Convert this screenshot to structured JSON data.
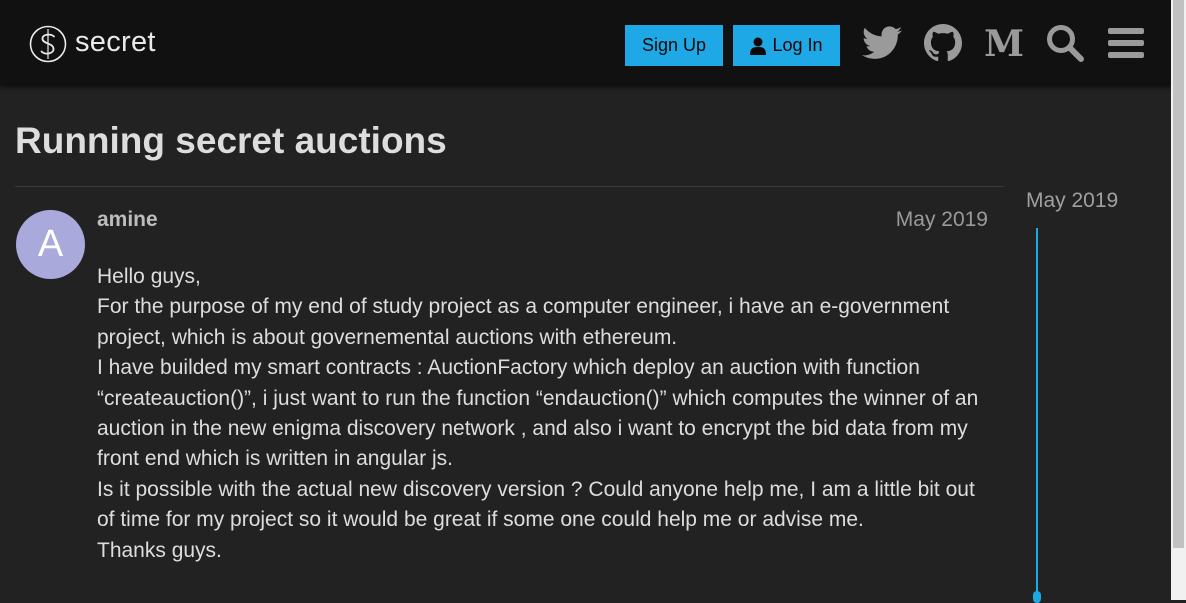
{
  "header": {
    "logo_text": "secret",
    "signup_label": "Sign Up",
    "login_label": "Log In",
    "icons": [
      "twitter-icon",
      "github-icon",
      "medium-icon",
      "search-icon",
      "menu-icon"
    ],
    "accent_color": "#1fa8e6"
  },
  "topic": {
    "title": "Running secret auctions"
  },
  "post": {
    "avatar_letter": "A",
    "username": "amine",
    "date": "May 2019",
    "paragraphs": [
      "Hello guys,",
      "For the purpose of my end of study project as a computer engineer, i have an e-government project, which is about governemental auctions with ethereum.",
      "I have builded my smart contracts : AuctionFactory which deploy an auction with function “createauction()”, i just want to run the function “endauction()” which computes the winner of an auction in the new enigma discovery network , and also i want to encrypt the bid data from my front end which is written in angular js.",
      "Is it possible with the actual new discovery version ? Could anyone help me, I am a little bit out of time for my project so it would be great if some one could help me or advise me.",
      "Thanks guys."
    ]
  },
  "timeline": {
    "label": "May 2019"
  }
}
